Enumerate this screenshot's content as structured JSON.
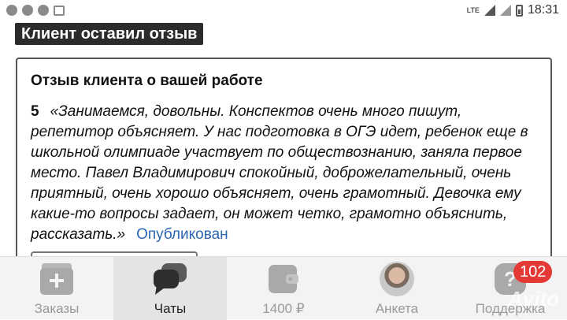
{
  "status_bar": {
    "network": "LTE",
    "time": "18:31"
  },
  "header": {
    "title": "Клиент оставил отзыв"
  },
  "card": {
    "heading": "Отзыв клиента о вашей работе",
    "rating": "5",
    "quote": "«Занимаемся, довольны. Конспектов очень много пишут, репетитор объясняет. У нас подготовка в ОГЭ идет, ребенок еще в школьной олимпиаде участвует по обществознанию, заняла первое место. Павел Владимирович спокойный, доброжелательный, очень приятный, очень хорошо объясняет, очень грамотный. Девочка ему какие-то вопросы задает, он может четко, грамотно объяснить, рассказать.»",
    "status": "Опубликован",
    "status_color": "#2a67b0"
  },
  "bottom_nav": {
    "items": [
      {
        "label": "Заказы",
        "icon": "orders-stack-icon",
        "active": false
      },
      {
        "label": "Чаты",
        "icon": "chat-bubbles-icon",
        "active": true
      },
      {
        "label": "1400 ₽",
        "icon": "wallet-icon",
        "active": false
      },
      {
        "label": "Анкета",
        "icon": "profile-avatar",
        "active": false
      },
      {
        "label": "Поддержка",
        "icon": "help-question-icon",
        "active": false
      }
    ],
    "badge": "102",
    "badge_color": "#e53935"
  },
  "watermark": "Avito"
}
